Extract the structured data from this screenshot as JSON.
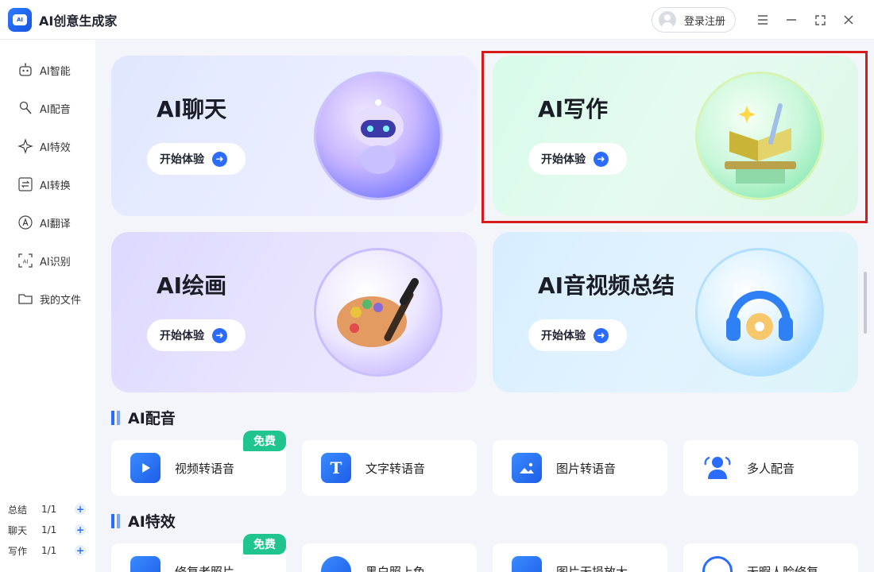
{
  "app": {
    "title": "AI创意生成家",
    "logo_text": "AI"
  },
  "titlebar": {
    "login_label": "登录注册",
    "menu_icon": "menu-icon",
    "minimize_icon": "minimize-icon",
    "maximize_icon": "maximize-icon",
    "close_icon": "close-icon"
  },
  "sidebar": {
    "items": [
      {
        "label": "AI智能",
        "icon": "robot-icon"
      },
      {
        "label": "AI配音",
        "icon": "microphone-icon"
      },
      {
        "label": "AI特效",
        "icon": "sparkle-icon"
      },
      {
        "label": "AI转换",
        "icon": "convert-icon"
      },
      {
        "label": "AI翻译",
        "icon": "translate-icon"
      },
      {
        "label": "AI识别",
        "icon": "scan-icon"
      },
      {
        "label": "我的文件",
        "icon": "folder-icon"
      }
    ],
    "counts": [
      {
        "label": "总结",
        "value": "1/1"
      },
      {
        "label": "聊天",
        "value": "1/1"
      },
      {
        "label": "写作",
        "value": "1/1"
      }
    ]
  },
  "feature_cards": {
    "chat": {
      "title": "AI聊天",
      "button": "开始体验"
    },
    "write": {
      "title": "AI写作",
      "button": "开始体验"
    },
    "draw": {
      "title": "AI绘画",
      "button": "开始体验"
    },
    "summary": {
      "title": "AI音视频总结",
      "button": "开始体验"
    }
  },
  "sections": {
    "dubbing": {
      "title": "AI配音",
      "tiles": [
        {
          "label": "视频转语音",
          "badge": "免费"
        },
        {
          "label": "文字转语音"
        },
        {
          "label": "图片转语音"
        },
        {
          "label": "多人配音"
        }
      ]
    },
    "effects": {
      "title": "AI特效",
      "tiles": [
        {
          "label": "修复老照片",
          "badge": "免费"
        },
        {
          "label": "黑白照上色"
        },
        {
          "label": "图片无损放大"
        },
        {
          "label": "无暇人脸修复"
        }
      ]
    }
  },
  "colors": {
    "accent": "#2b6cff",
    "badge": "#1fc48e",
    "highlight": "#d61a1a"
  }
}
